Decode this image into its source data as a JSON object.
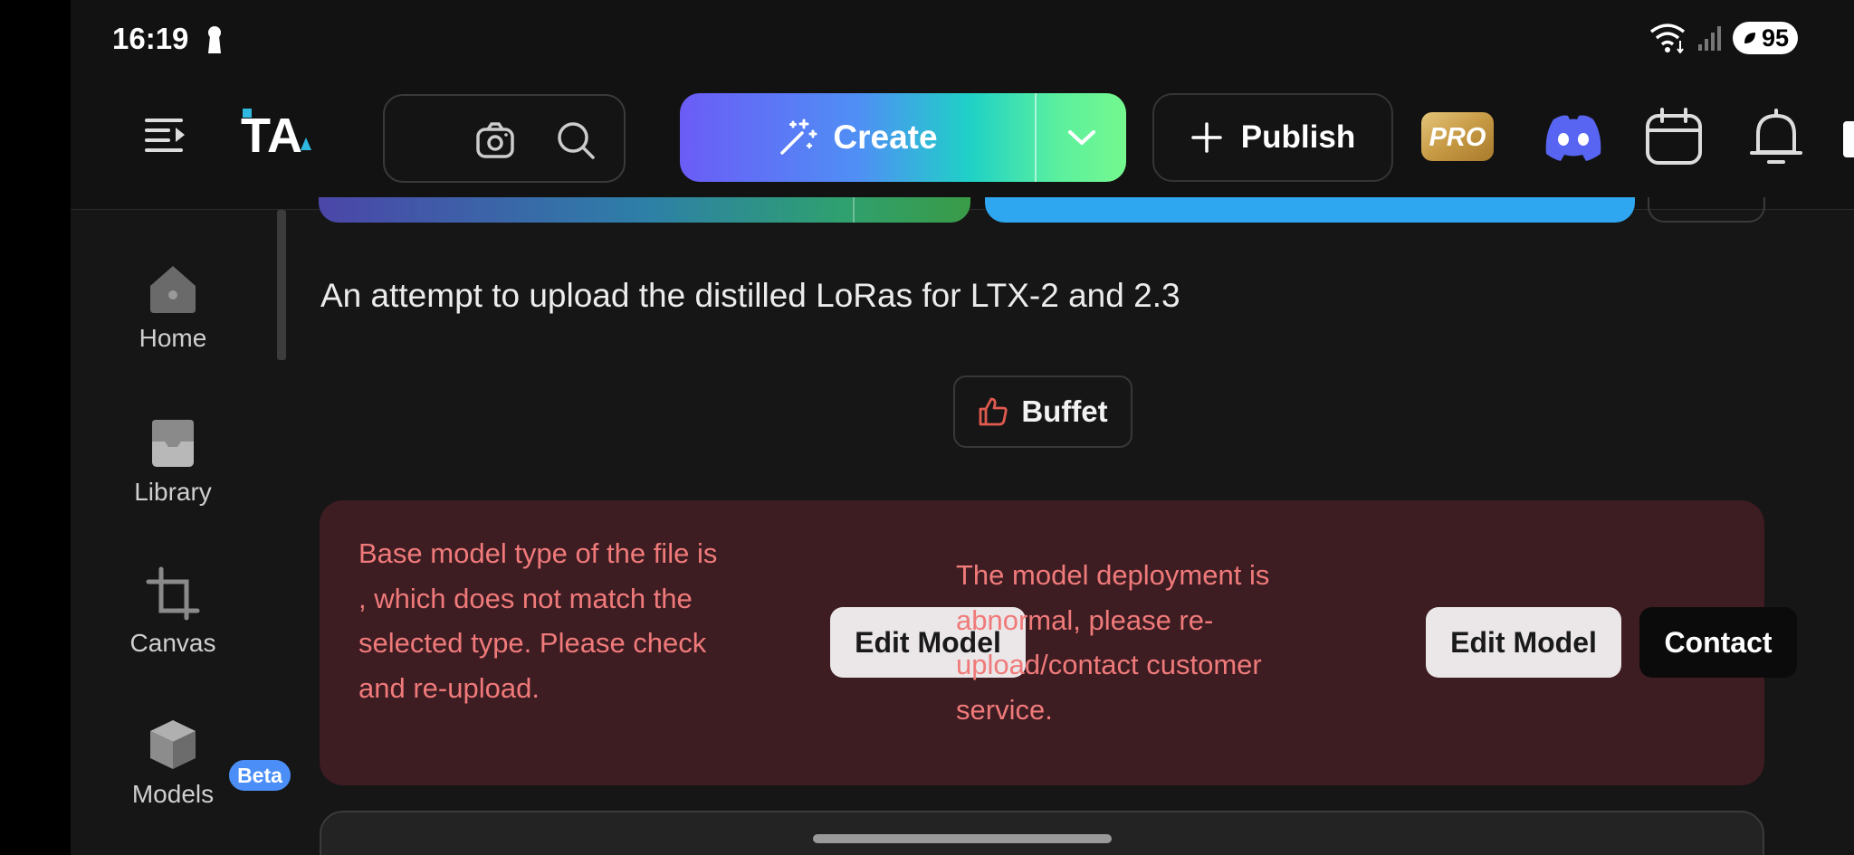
{
  "status_bar": {
    "time": "16:19",
    "battery": "95"
  },
  "header": {
    "logo_text": "TA",
    "create_label": "Create",
    "publish_label": "Publish",
    "pro_label": "PRO"
  },
  "sidebar": {
    "items": [
      {
        "label": "Home",
        "icon": "home-icon"
      },
      {
        "label": "Library",
        "icon": "library-icon"
      },
      {
        "label": "Canvas",
        "icon": "canvas-icon"
      },
      {
        "label": "Models",
        "icon": "models-icon"
      }
    ],
    "beta_badge": "Beta"
  },
  "main": {
    "description": "An attempt to upload the distilled LoRas for LTX-2 and 2.3",
    "buffet_label": "Buffet",
    "errors": [
      {
        "message": "Base model type of the file is , which does not match the selected type. Please check and re-upload.",
        "action": "Edit Model"
      },
      {
        "message": "The model deployment is abnormal, please re-upload/contact customer service.",
        "action": "Edit Model",
        "secondary_action": "Contact"
      }
    ]
  },
  "colors": {
    "error_bg": "#3d1c22",
    "error_text": "#f07a7a",
    "accent_blue": "#4b8ef7",
    "thumb_red": "#e05a4f"
  }
}
